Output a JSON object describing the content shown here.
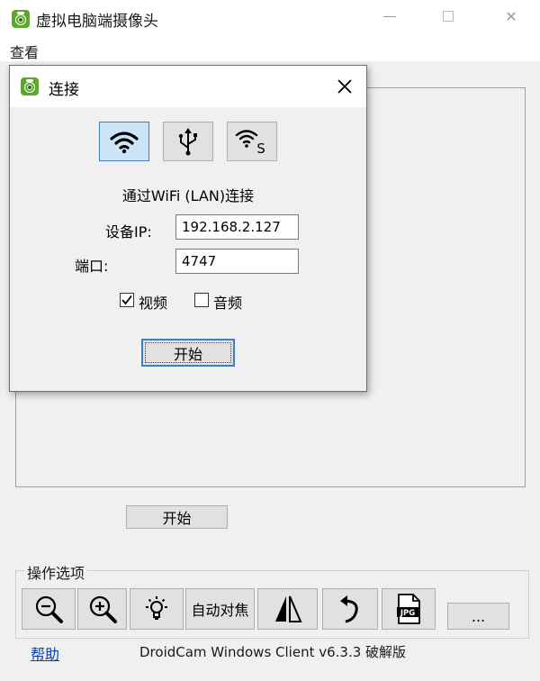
{
  "window": {
    "title": "虚拟电脑端摄像头",
    "min_label": "—",
    "close_label": "✕"
  },
  "menu": {
    "view": "查看"
  },
  "main": {
    "start_label": "开始",
    "options_group_label": "操作选项",
    "tools": [
      {
        "icon": "zoom-out-icon"
      },
      {
        "icon": "zoom-in-icon"
      },
      {
        "icon": "light-bulb-icon"
      },
      {
        "label": "自动对焦"
      },
      {
        "icon": "mirror-flip-icon"
      },
      {
        "icon": "rotate-icon"
      },
      {
        "icon": "jpg-snapshot-icon"
      },
      {
        "label": "..."
      }
    ],
    "help_label": "帮助",
    "version": "DroidCam Windows Client v6.3.3 破解版"
  },
  "dialog": {
    "title": "连接",
    "close_label": "✕",
    "modes": [
      {
        "icon": "wifi-icon",
        "active": true
      },
      {
        "icon": "usb-icon",
        "active": false
      },
      {
        "icon": "wifi-server-icon",
        "active": false
      }
    ],
    "mode_caption": "通过WiFi (LAN)连接",
    "device_ip_label": "设备IP:",
    "device_ip_value": "192.168.2.127",
    "port_label": "端口:",
    "port_value": "4747",
    "video_label": "视频",
    "video_checked": true,
    "audio_label": "音频",
    "audio_checked": false,
    "start_label": "开始"
  },
  "colors": {
    "accent": "#3d7ec6",
    "app_icon": "#5aa92c",
    "link": "#0b3fa8"
  }
}
